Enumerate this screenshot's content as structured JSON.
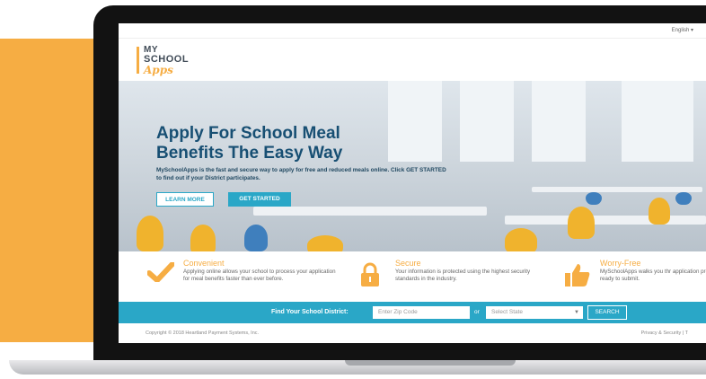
{
  "colors": {
    "accent": "#f6ad43",
    "teal": "#2aa7c7",
    "title": "#174f73"
  },
  "topbar": {
    "language": "English ▾"
  },
  "logo": {
    "line1": "MY",
    "line2": "SCHOOL",
    "line3": "Apps"
  },
  "hero": {
    "title_line1": "Apply For School Meal",
    "title_line2": "Benefits The Easy Way",
    "description": "MySchoolApps is the fast and secure way to apply for free and reduced meals online. Click GET STARTED to find out if your District participates.",
    "learn_more": "LEARN MORE",
    "get_started": "GET STARTED"
  },
  "features": [
    {
      "title": "Convenient",
      "text": "Applying online allows your school to process your application for meal benefits faster than ever before.",
      "icon": "checkmark-icon"
    },
    {
      "title": "Secure",
      "text": "Your information is protected using the highest security standards in the industry.",
      "icon": "padlock-icon"
    },
    {
      "title": "Worry-Free",
      "text": "MySchoolApps walks you thr application process, ensurin and ready to submit.",
      "icon": "thumbs-up-icon"
    }
  ],
  "district": {
    "label": "Find Your School District:",
    "zip_placeholder": "Enter Zip Code",
    "or": "or",
    "state_placeholder": "Select State",
    "search": "SEARCH"
  },
  "footer": {
    "copyright": "Copyright © 2018 Heartland Payment Systems, Inc.",
    "privacy": "Privacy & Security  |  T"
  }
}
